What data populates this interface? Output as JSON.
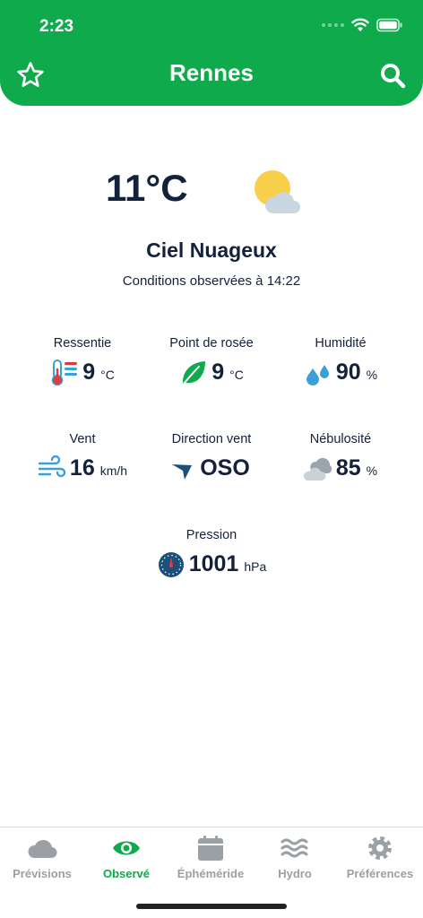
{
  "status": {
    "time": "2:23"
  },
  "header": {
    "title": "Rennes",
    "favorite_icon": "star-icon",
    "search_icon": "search-icon"
  },
  "current": {
    "temperature": "11°C",
    "condition": "Ciel Nuageux",
    "observed_at": "Conditions observées à 14:22",
    "icon": "partly-cloudy-icon"
  },
  "metrics": [
    {
      "label": "Ressentie",
      "value": "9",
      "unit": "°C",
      "icon": "thermometer-icon"
    },
    {
      "label": "Point de rosée",
      "value": "9",
      "unit": "°C",
      "icon": "leaf-icon"
    },
    {
      "label": "Humidité",
      "value": "90",
      "unit": "%",
      "icon": "droplets-icon"
    },
    {
      "label": "Vent",
      "value": "16",
      "unit": "km/h",
      "icon": "wind-icon"
    },
    {
      "label": "Direction vent",
      "value": "OSO",
      "unit": "",
      "icon": "wind-direction-arrow-icon"
    },
    {
      "label": "Nébulosité",
      "value": "85",
      "unit": "%",
      "icon": "clouds-icon"
    },
    {
      "label": "Pression",
      "value": "1001",
      "unit": "hPa",
      "icon": "barometer-icon"
    }
  ],
  "tabs": [
    {
      "label": "Prévisions",
      "icon": "cloud-icon",
      "active": false
    },
    {
      "label": "Observé",
      "icon": "eye-icon",
      "active": true
    },
    {
      "label": "Éphéméride",
      "icon": "calendar-icon",
      "active": false
    },
    {
      "label": "Hydro",
      "icon": "waves-icon",
      "active": false
    },
    {
      "label": "Préférences",
      "icon": "gear-icon",
      "active": false
    }
  ],
  "colors": {
    "brand_green": "#0eaa4b",
    "text_dark": "#13213a",
    "tab_inactive": "#9aa1a6",
    "icon_blue": "#3b9fd8",
    "sun_yellow": "#f8cf4a"
  }
}
